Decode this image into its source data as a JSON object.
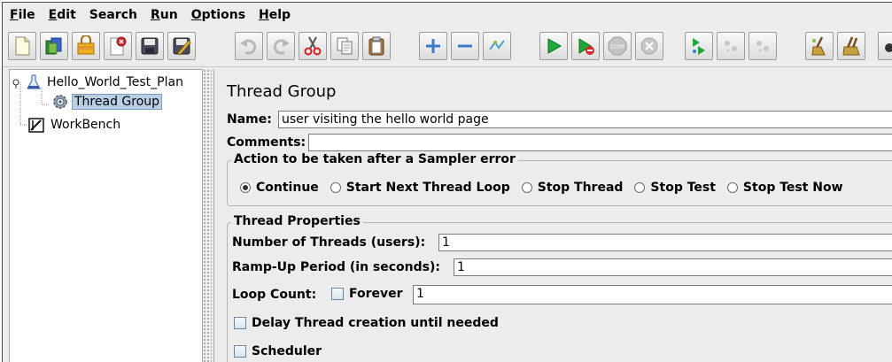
{
  "menu": {
    "items": [
      {
        "first": "F",
        "rest": "ile"
      },
      {
        "first": "E",
        "rest": "dit"
      },
      {
        "first": "",
        "rest": "Search"
      },
      {
        "first": "R",
        "rest": "un"
      },
      {
        "first": "O",
        "rest": "ptions"
      },
      {
        "first": "H",
        "rest": "elp"
      }
    ]
  },
  "toolbar": {
    "icons": [
      "new-icon",
      "templates-icon",
      "open-icon",
      "close-icon",
      "save-icon",
      "save-as-icon",
      "undo-icon",
      "redo-icon",
      "cut-icon",
      "copy-icon",
      "paste-icon",
      "expand-icon",
      "collapse-icon",
      "toggle-icon",
      "start-icon",
      "start-no-pause-icon",
      "stop-icon",
      "shutdown-icon",
      "remote-start-icon",
      "remote-stop-icon",
      "remote-shutdown-icon",
      "clear-icon",
      "clear-all-icon",
      "search-icon"
    ]
  },
  "tree": {
    "root": "Hello_World_Test_Plan",
    "child": "Thread Group",
    "workbench": "WorkBench"
  },
  "panel": {
    "title": "Thread Group",
    "name_label": "Name:",
    "name_value": "user visiting the hello world page",
    "comments_label": "Comments:",
    "comments_value": "",
    "sampler_error": {
      "title": "Action to be taken after a Sampler error",
      "options": [
        {
          "label": "Continue",
          "selected": true
        },
        {
          "label": "Start Next Thread Loop",
          "selected": false
        },
        {
          "label": "Stop Thread",
          "selected": false
        },
        {
          "label": "Stop Test",
          "selected": false
        },
        {
          "label": "Stop Test Now",
          "selected": false
        }
      ]
    },
    "thread_props": {
      "title": "Thread Properties",
      "threads_label": "Number of Threads (users):",
      "threads_value": "1",
      "rampup_label": "Ramp-Up Period (in seconds):",
      "rampup_value": "1",
      "loop_label": "Loop Count:",
      "forever_label": "Forever",
      "forever_checked": false,
      "loop_value": "1",
      "delay_label": "Delay Thread creation until needed",
      "delay_checked": false,
      "scheduler_label": "Scheduler",
      "scheduler_checked": false
    }
  }
}
